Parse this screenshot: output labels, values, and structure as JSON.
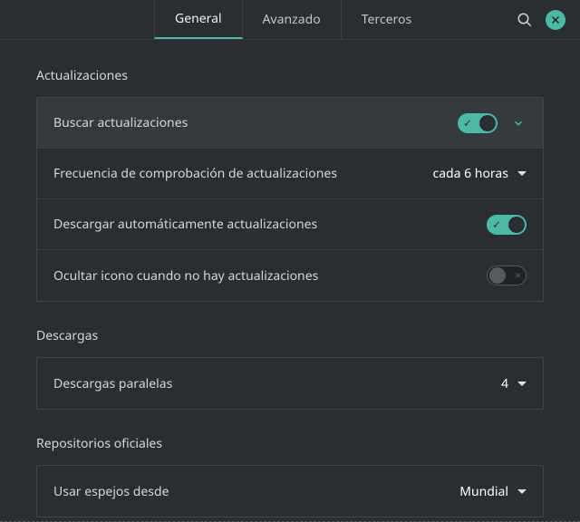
{
  "tabs": {
    "general": "General",
    "advanced": "Avanzado",
    "third_party": "Terceros"
  },
  "sections": {
    "updates": {
      "title": "Actualizaciones",
      "check_updates": "Buscar actualizaciones",
      "frequency_label": "Frecuencia de comprobación de actualizaciones",
      "frequency_value": "cada 6 horas",
      "auto_download": "Descargar automáticamente actualizaciones",
      "hide_icon": "Ocultar icono cuando no hay actualizaciones"
    },
    "downloads": {
      "title": "Descargas",
      "parallel_label": "Descargas paralelas",
      "parallel_value": "4"
    },
    "repos": {
      "title": "Repositorios oficiales",
      "mirror_label": "Usar espejos desde",
      "mirror_value": "Mundial"
    }
  }
}
